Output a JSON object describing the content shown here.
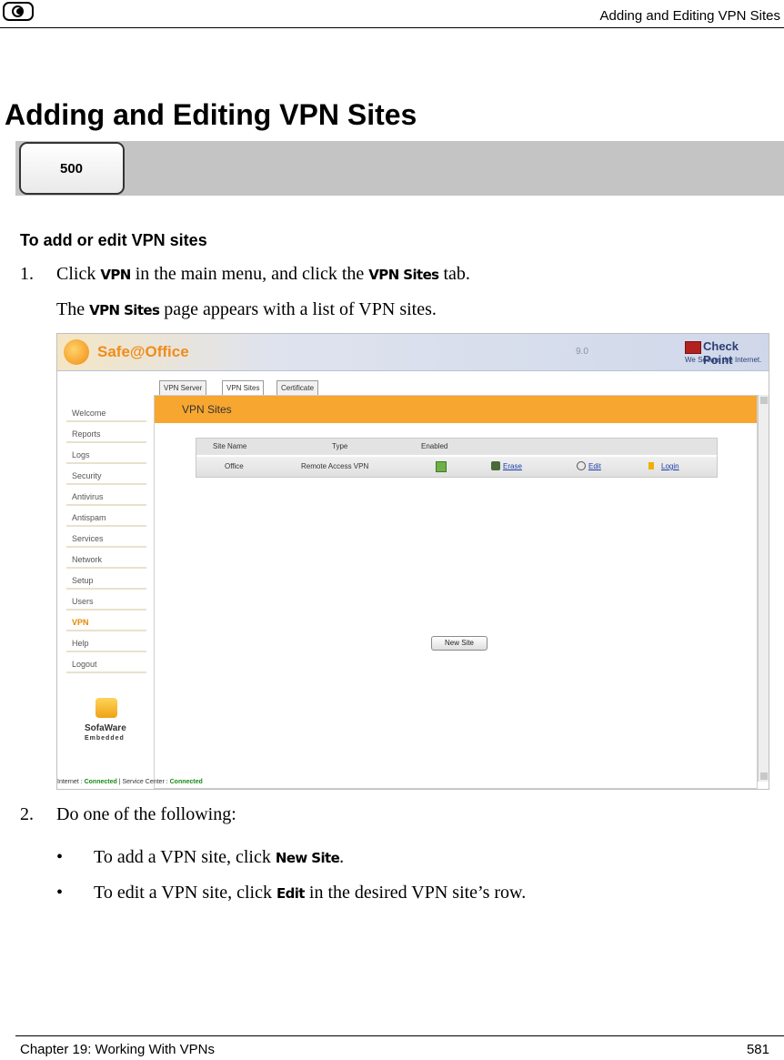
{
  "header": {
    "running_title": "Adding and Editing VPN Sites"
  },
  "section": {
    "title": "Adding and Editing VPN Sites",
    "badge": "500"
  },
  "procedure": {
    "title": "To add or edit VPN sites",
    "step1": {
      "num": "1.",
      "pre": "Click ",
      "ui1": "VPN",
      "mid": " in the main menu, and click the ",
      "ui2": "VPN Sites",
      "post": " tab."
    },
    "result": {
      "pre": "The ",
      "ui": "VPN Sites",
      "post": " page appears with a list of VPN sites."
    },
    "step2": {
      "num": "2.",
      "text": "Do one of the following:"
    },
    "bullets": [
      {
        "pre": "To add a VPN site, click ",
        "ui": "New Site",
        "post": "."
      },
      {
        "pre": "To edit a VPN site, click ",
        "ui": "Edit",
        "post": " in the desired VPN site’s row."
      }
    ]
  },
  "screenshot": {
    "app_name": "Safe@Office",
    "version": "9.0",
    "brand": "Check Point",
    "brand_sub": "We Secure the Internet.",
    "sidebar": [
      "Welcome",
      "Reports",
      "Logs",
      "Security",
      "Antivirus",
      "Antispam",
      "Services",
      "Network",
      "Setup",
      "Users",
      "VPN",
      "Help",
      "Logout"
    ],
    "active_item": "VPN",
    "tabs": [
      "VPN Server",
      "VPN Sites",
      "Certificate"
    ],
    "active_tab": "VPN Sites",
    "panel_title": "VPN Sites",
    "columns": [
      "Site Name",
      "Type",
      "Enabled"
    ],
    "row": {
      "site": "Office",
      "type": "Remote Access VPN",
      "erase": "Erase",
      "edit": "Edit",
      "login": "Login"
    },
    "new_site": "New Site",
    "sofaware_name": "SofaWare",
    "sofaware_sub": "Embedded",
    "status": {
      "internet_label": "Internet :",
      "internet": "Connected",
      "sc_label": "Service Center :",
      "sc": "Connected"
    },
    "colors": {
      "accent": "#f7a630",
      "active_menu": "#e58a00",
      "connected": "#1a8a1a",
      "link": "#1a3ea8"
    }
  },
  "footer": {
    "chapter": "Chapter 19: Working With VPNs",
    "page": "581"
  }
}
